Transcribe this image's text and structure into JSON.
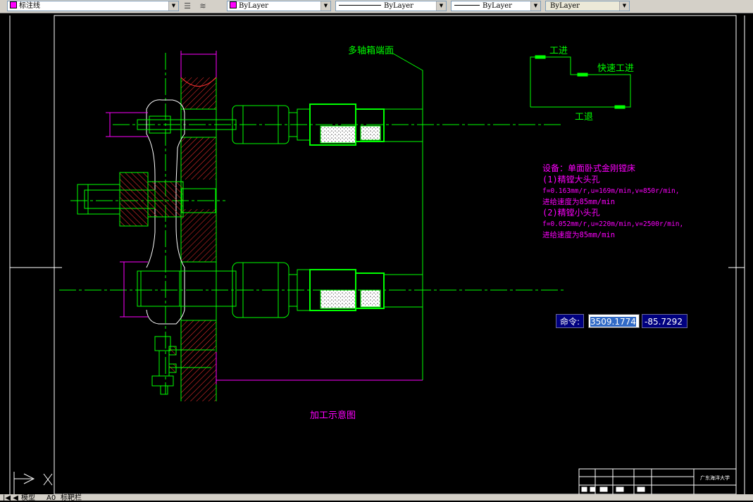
{
  "colors": {
    "background": "#000000",
    "green": "#00ff00",
    "magenta": "#ff00ff",
    "white": "#ffffff",
    "hatch_red": "#ff3030",
    "toolbar_gray": "#d4d0c8",
    "cmd_blue": "#00007f"
  },
  "toolbar": {
    "dimstyle": {
      "name": "标注线",
      "color": "magenta"
    },
    "layer_icons": [
      "layer-stack-icon",
      "layer-states-icon"
    ],
    "color_control": {
      "label": "ByLayer",
      "swatch_color": "#ff00ff"
    },
    "linetype_control": {
      "label": "ByLayer"
    },
    "lineweight_control": {
      "label": "ByLayer"
    },
    "plotstyle_control": {
      "label": "ByLayer"
    }
  },
  "drawing": {
    "labels": {
      "face_label": "多轴箱端面",
      "feed_work": "工进",
      "feed_fast": "快速工进",
      "feed_return": "工退",
      "caption": "加工示意图",
      "title_block_school": "广东海洋大学"
    },
    "notes": [
      "设备：单面卧式金刚镗床",
      "(1)精镗大头孔",
      "f=0.163mm/r,u=169m/min,v=850r/min,",
      "进给速度为85mm/min",
      "(2)精镗小头孔",
      "f=0.052mm/r,u=220m/min,v=2500r/min,",
      "进给速度为85mm/min"
    ]
  },
  "command": {
    "label": "命令:",
    "x_value": "3509.1774",
    "y_value": "-85.7292"
  },
  "tabs": {
    "model": "模型",
    "layout1": "A0",
    "layout2": "标靶栏"
  }
}
